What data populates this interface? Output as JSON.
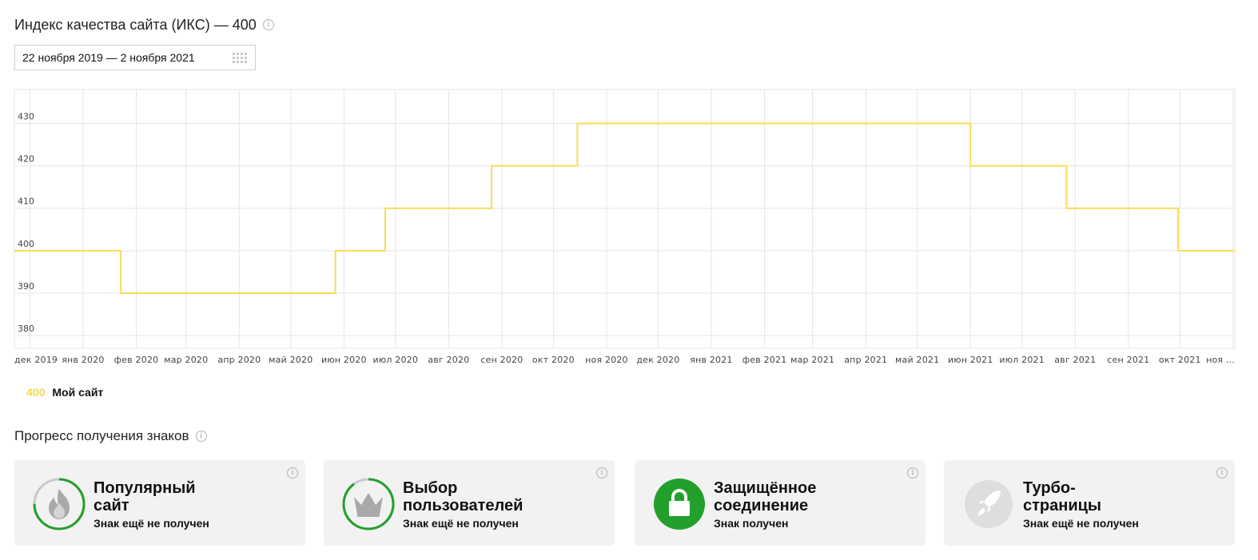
{
  "header": {
    "title": "Индекс качества сайта (ИКС) — 400",
    "info_icon": "i"
  },
  "date_range": {
    "value": "22 ноября 2019 — 2 ноября 2021",
    "icon": "calendar-icon"
  },
  "chart_data": {
    "type": "line",
    "x_tick_labels": [
      "дек 2019",
      "янв 2020",
      "фев 2020",
      "мар 2020",
      "апр 2020",
      "май 2020",
      "июн 2020",
      "июл 2020",
      "авг 2020",
      "сен 2020",
      "окт 2020",
      "ноя 2020",
      "дек 2020",
      "янв 2021",
      "фев 2021",
      "мар 2021",
      "апр 2021",
      "май 2021",
      "июн 2021",
      "июл 2021",
      "авг 2021",
      "сен 2021",
      "окт 2021",
      "ноя ..."
    ],
    "y_ticks": [
      380,
      390,
      400,
      410,
      420,
      430
    ],
    "ylim": [
      377,
      438
    ],
    "xlim": [
      "2019-11-22",
      "2021-11-02"
    ],
    "grid": true,
    "step": true,
    "color": "#f7dc5a",
    "series": [
      {
        "name": "Мой сайт",
        "points": [
          {
            "x": "2019-11-22",
            "y": 400
          },
          {
            "x": "2020-01-23",
            "y": 390
          },
          {
            "x": "2020-05-27",
            "y": 400
          },
          {
            "x": "2020-06-25",
            "y": 410
          },
          {
            "x": "2020-08-26",
            "y": 420
          },
          {
            "x": "2020-10-15",
            "y": 430
          },
          {
            "x": "2021-06-01",
            "y": 420
          },
          {
            "x": "2021-07-27",
            "y": 410
          },
          {
            "x": "2021-09-30",
            "y": 400
          },
          {
            "x": "2021-11-02",
            "y": 400
          }
        ]
      }
    ]
  },
  "legend": {
    "value": "400",
    "name": "Мой сайт",
    "color": "#f5d84b"
  },
  "badges_section": {
    "title": "Прогресс получения знаков",
    "info_icon": "i",
    "cards": [
      {
        "title_line1": "Популярный",
        "title_line2": "сайт",
        "status": "Знак ещё не получен",
        "icon": "flame-icon",
        "progress": 0.75,
        "received": false
      },
      {
        "title_line1": "Выбор",
        "title_line2": "пользователей",
        "status": "Знак ещё не получен",
        "icon": "crown-icon",
        "progress": 0.9,
        "received": false
      },
      {
        "title_line1": "Защищённое",
        "title_line2": "соединение",
        "status": "Знак получен",
        "icon": "lock-icon",
        "progress": 1,
        "received": true
      },
      {
        "title_line1": "Турбо-",
        "title_line2": "страницы",
        "status": "Знак ещё не получен",
        "icon": "rocket-icon",
        "progress": 0,
        "received": false
      }
    ]
  },
  "colors": {
    "accent_green": "#22a02b",
    "line_yellow": "#f7dc5a",
    "card_bg": "#f2f2f2",
    "grid": "#e5e5e5"
  }
}
